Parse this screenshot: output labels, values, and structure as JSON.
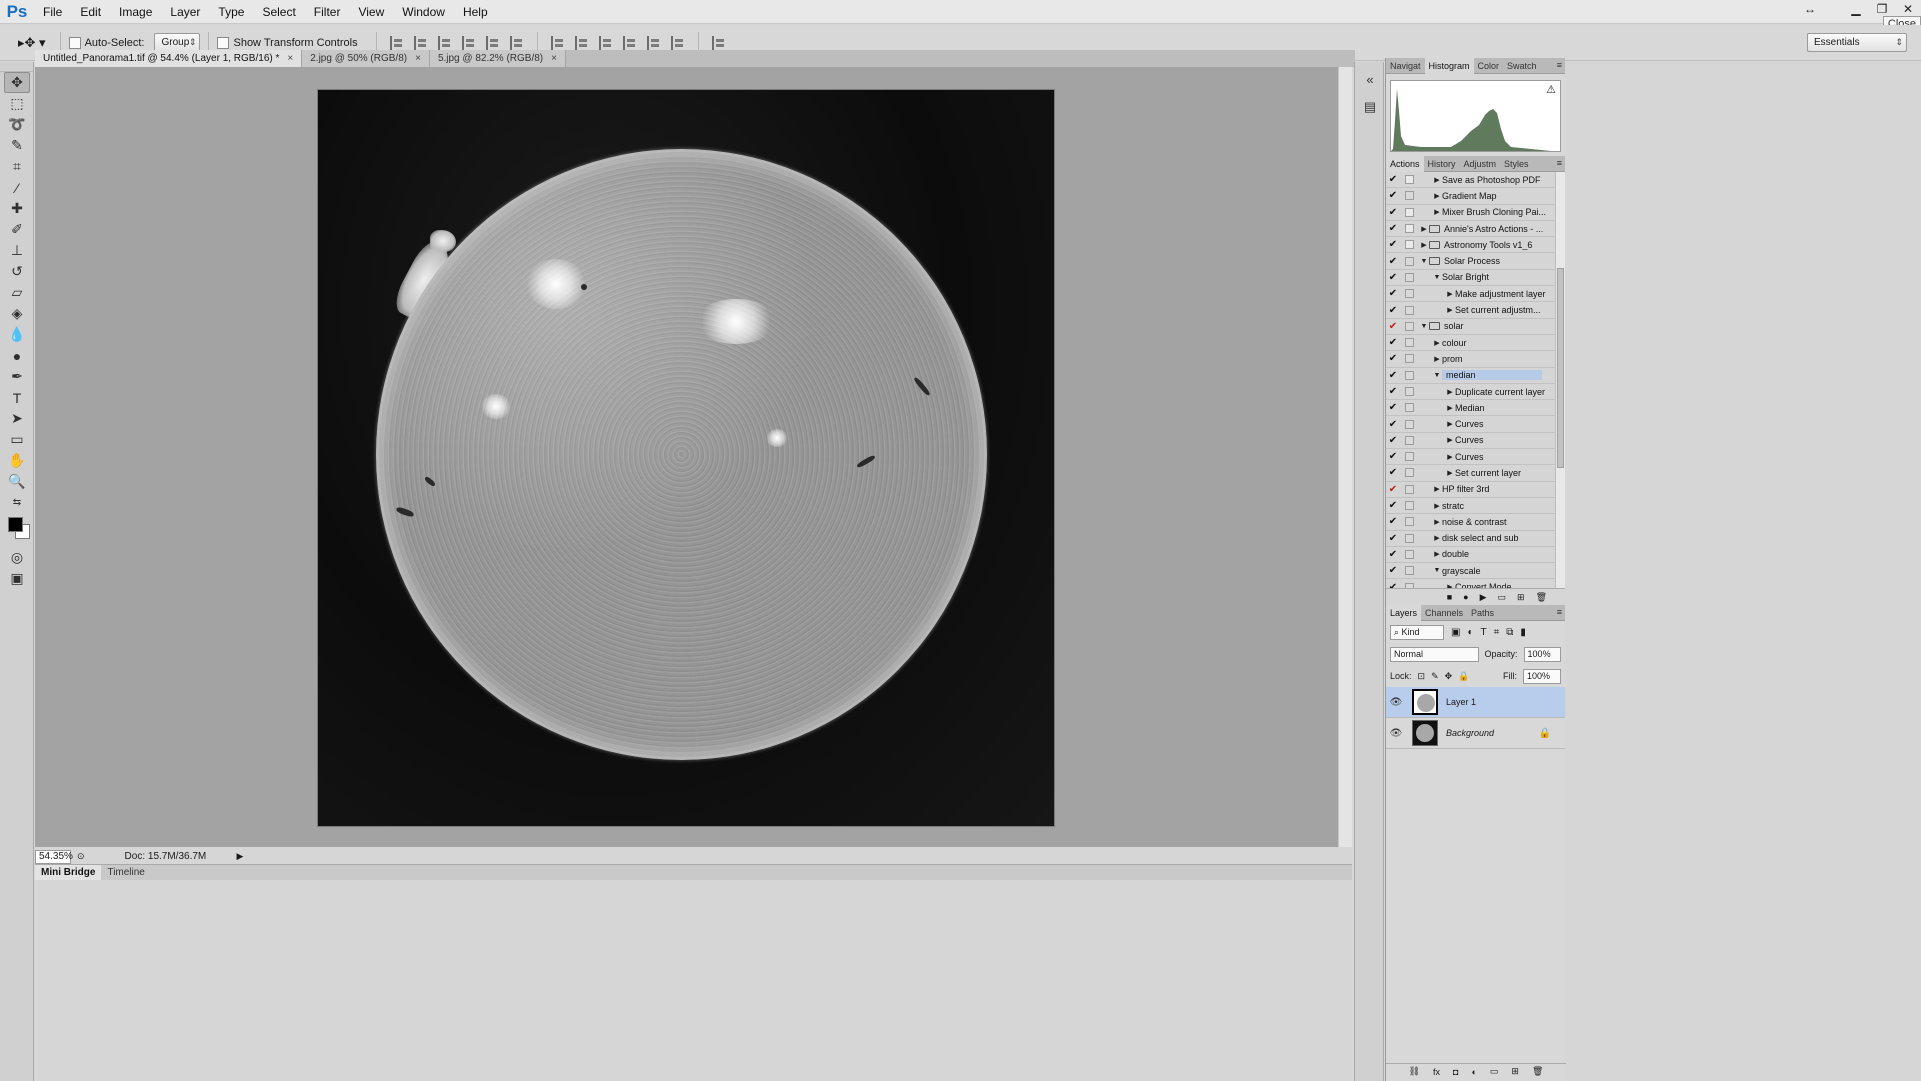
{
  "app": {
    "logo": "Ps"
  },
  "menu": [
    "File",
    "Edit",
    "Image",
    "Layer",
    "Type",
    "Select",
    "Filter",
    "View",
    "Window",
    "Help"
  ],
  "window_controls": {
    "close_tooltip": "Close"
  },
  "options": {
    "auto_select_label": "Auto-Select:",
    "auto_select_checked": false,
    "auto_select_mode": "Group",
    "show_transform_label": "Show Transform Controls",
    "show_transform_checked": false,
    "workspace": "Essentials"
  },
  "tools": [
    "move-tool",
    "marquee-tool",
    "lasso-tool",
    "quick-selection-tool",
    "crop-tool",
    "eyedropper-tool",
    "spot-healing-tool",
    "brush-tool",
    "clone-stamp-tool",
    "history-brush-tool",
    "eraser-tool",
    "paint-bucket-tool",
    "blur-tool",
    "dodge-tool",
    "pen-tool",
    "type-tool",
    "path-selection-tool",
    "rectangle-tool",
    "hand-tool",
    "zoom-tool"
  ],
  "document_tabs": [
    {
      "label": "Untitled_Panorama1.tif @ 54.4% (Layer 1, RGB/16) *",
      "active": true
    },
    {
      "label": "2.jpg @ 50% (RGB/8)",
      "active": false
    },
    {
      "label": "5.jpg @ 82.2% (RGB/8)",
      "active": false
    }
  ],
  "status": {
    "zoom": "54.35%",
    "doc_info": "Doc: 15.7M/36.7M"
  },
  "bottom_tabs": [
    "Mini Bridge",
    "Timeline"
  ],
  "panel_histogram": {
    "tabs": [
      "Navigat",
      "Histogram",
      "Color",
      "Swatch"
    ],
    "active": "Histogram"
  },
  "panel_actions": {
    "tabs": [
      "Actions",
      "History",
      "Adjustm",
      "Styles"
    ],
    "active": "Actions",
    "rows": [
      {
        "label": "Save as Photoshop PDF",
        "level": 1,
        "expanded": false,
        "check": "black",
        "dialog": true
      },
      {
        "label": "Gradient Map",
        "level": 1,
        "expanded": false,
        "check": "black",
        "dialog": false
      },
      {
        "label": "Mixer Brush Cloning Pai...",
        "level": 1,
        "expanded": false,
        "check": "black",
        "dialog": true
      },
      {
        "label": "Annie's Astro Actions - ...",
        "level": 0,
        "folder": true,
        "expanded": false,
        "check": "black",
        "dialog": true
      },
      {
        "label": "Astronomy Tools v1_6",
        "level": 0,
        "folder": true,
        "expanded": false,
        "check": "black",
        "dialog": true
      },
      {
        "label": "Solar Process",
        "level": 0,
        "folder": true,
        "expanded": true,
        "check": "black",
        "dialog": false
      },
      {
        "label": "Solar Bright",
        "level": 1,
        "expanded": true,
        "check": "black",
        "dialog": false
      },
      {
        "label": "Make adjustment layer",
        "level": 2,
        "expanded": false,
        "check": "black",
        "dialog": false
      },
      {
        "label": "Set current adjustm...",
        "level": 2,
        "expanded": false,
        "check": "black",
        "dialog": false
      },
      {
        "label": "solar",
        "level": 0,
        "folder": true,
        "expanded": true,
        "check": "red",
        "dialog": false
      },
      {
        "label": "colour",
        "level": 1,
        "expanded": false,
        "check": "black",
        "dialog": false
      },
      {
        "label": "prom",
        "level": 1,
        "expanded": false,
        "check": "black",
        "dialog": false
      },
      {
        "label": "median",
        "level": 1,
        "expanded": true,
        "check": "black",
        "dialog": false,
        "selected": true
      },
      {
        "label": "Duplicate current layer",
        "level": 2,
        "expanded": false,
        "check": "black",
        "dialog": false
      },
      {
        "label": "Median",
        "level": 2,
        "expanded": false,
        "check": "black",
        "dialog": false
      },
      {
        "label": "Curves",
        "level": 2,
        "expanded": false,
        "check": "black",
        "dialog": false
      },
      {
        "label": "Curves",
        "level": 2,
        "expanded": false,
        "check": "black",
        "dialog": false
      },
      {
        "label": "Curves",
        "level": 2,
        "expanded": false,
        "check": "black",
        "dialog": false
      },
      {
        "label": "Set current layer",
        "level": 2,
        "expanded": false,
        "check": "black",
        "dialog": false
      },
      {
        "label": "HP filter 3rd",
        "level": 1,
        "expanded": false,
        "check": "red",
        "dialog": false
      },
      {
        "label": "stratc",
        "level": 1,
        "expanded": false,
        "check": "black",
        "dialog": false
      },
      {
        "label": "noise & contrast",
        "level": 1,
        "expanded": false,
        "check": "black",
        "dialog": false
      },
      {
        "label": "disk select and sub",
        "level": 1,
        "expanded": false,
        "check": "black",
        "dialog": false
      },
      {
        "label": "double",
        "level": 1,
        "expanded": false,
        "check": "black",
        "dialog": false
      },
      {
        "label": "grayscale",
        "level": 1,
        "expanded": true,
        "check": "black",
        "dialog": false
      },
      {
        "label": "Convert Mode",
        "level": 2,
        "expanded": false,
        "check": "black",
        "dialog": false
      }
    ]
  },
  "panel_layers": {
    "tabs": [
      "Layers",
      "Channels",
      "Paths"
    ],
    "active": "Layers",
    "filter_kind": "Kind",
    "blend_mode": "Normal",
    "opacity_label": "Opacity:",
    "opacity": "100%",
    "lock_label": "Lock:",
    "fill_label": "Fill:",
    "fill": "100%",
    "layers": [
      {
        "name": "Layer 1",
        "selected": true,
        "locked": false
      },
      {
        "name": "Background",
        "selected": false,
        "locked": true
      }
    ]
  },
  "colors": {
    "accent_selection": "#b8cdeb",
    "canvas_bg": "#a3a3a3",
    "ps_blue": "#1b6fc2",
    "red_check": "#c41b1b"
  }
}
